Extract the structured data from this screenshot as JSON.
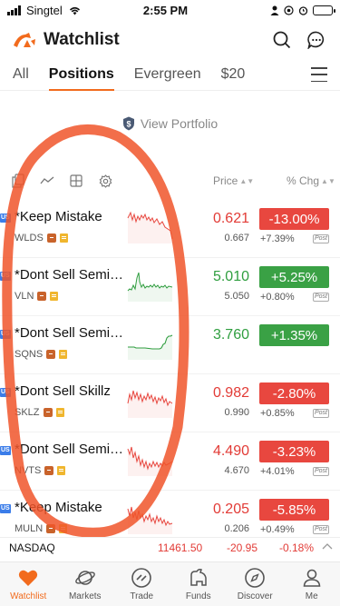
{
  "status": {
    "carrier": "Singtel",
    "time": "2:55 PM"
  },
  "header": {
    "title": "Watchlist"
  },
  "tabs": [
    {
      "label": "All",
      "active": false
    },
    {
      "label": "Positions",
      "active": true
    },
    {
      "label": "Evergreen",
      "active": false
    },
    {
      "label": "$20",
      "active": false
    }
  ],
  "portfolio": {
    "label": "View Portfolio"
  },
  "columns": {
    "price": "Price",
    "chg": "% Chg"
  },
  "rows": [
    {
      "market": "US",
      "name": "*Keep Mistake",
      "ticker": "WLDS",
      "price": "0.621",
      "pre_price": "0.667",
      "chg": "-13.00%",
      "pre_chg": "+7.39%",
      "post": "Post",
      "trend": "down"
    },
    {
      "market": "US",
      "name": "*Dont Sell Semico...",
      "ticker": "VLN",
      "price": "5.010",
      "pre_price": "5.050",
      "chg": "+5.25%",
      "pre_chg": "+0.80%",
      "post": "Post",
      "trend": "up"
    },
    {
      "market": "US",
      "name": "*Dont Sell Semico...",
      "ticker": "SQNS",
      "price": "3.760",
      "pre_price": "",
      "chg": "+1.35%",
      "pre_chg": "",
      "post": "",
      "trend": "up"
    },
    {
      "market": "US",
      "name": "*Dont Sell Skillz",
      "ticker": "SKLZ",
      "price": "0.982",
      "pre_price": "0.990",
      "chg": "-2.80%",
      "pre_chg": "+0.85%",
      "post": "Post",
      "trend": "down"
    },
    {
      "market": "US",
      "name": "*Dont Sell Semico...",
      "ticker": "NVTS",
      "price": "4.490",
      "pre_price": "4.670",
      "chg": "-3.23%",
      "pre_chg": "+4.01%",
      "post": "Post",
      "trend": "down"
    },
    {
      "market": "US",
      "name": "*Keep Mistake",
      "ticker": "MULN",
      "price": "0.205",
      "pre_price": "0.206",
      "chg": "-5.85%",
      "pre_chg": "+0.49%",
      "post": "Post",
      "trend": "down"
    }
  ],
  "ticker": {
    "index": "NASDAQ",
    "value": "11461.50",
    "change": "-20.95",
    "pct": "-0.18%"
  },
  "nav": [
    {
      "label": "Watchlist",
      "icon": "heart-icon",
      "active": true
    },
    {
      "label": "Markets",
      "icon": "planet-icon",
      "active": false
    },
    {
      "label": "Trade",
      "icon": "trade-icon",
      "active": false
    },
    {
      "label": "Funds",
      "icon": "funds-icon",
      "active": false
    },
    {
      "label": "Discover",
      "icon": "compass-icon",
      "active": false
    },
    {
      "label": "Me",
      "icon": "person-icon",
      "active": false
    }
  ],
  "colors": {
    "accent": "#f26b1d",
    "down": "#e8473f",
    "up": "#3aa145",
    "annotation": "#f0552a"
  }
}
